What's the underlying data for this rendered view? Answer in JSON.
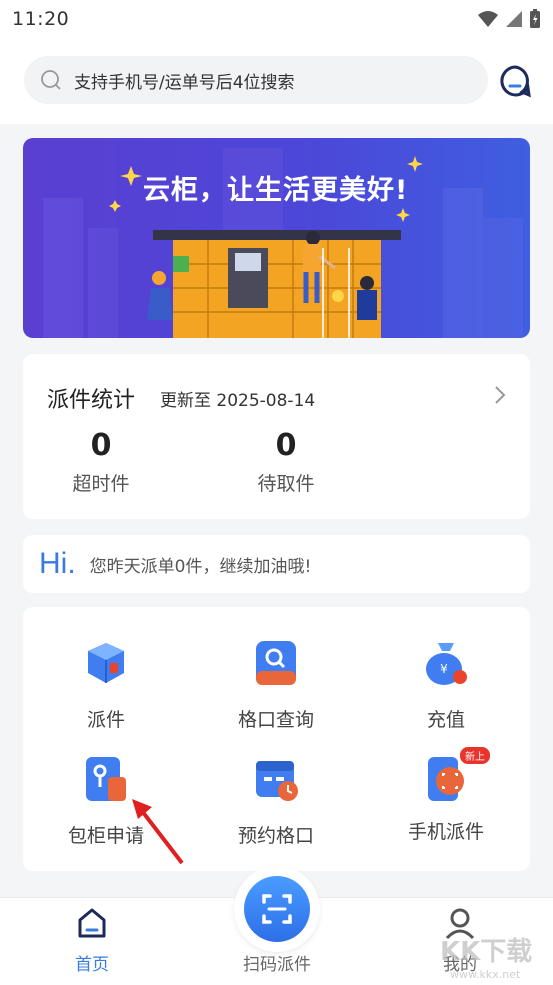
{
  "status_bar": {
    "time": "11:20"
  },
  "search": {
    "placeholder": "支持手机号/运单号后4位搜索"
  },
  "banner": {
    "title": "云柜，让生活更美好!"
  },
  "stats": {
    "title": "派件统计",
    "updated": "更新至 2025-08-14",
    "items": [
      {
        "value": "0",
        "label": "超时件"
      },
      {
        "value": "0",
        "label": "待取件"
      }
    ]
  },
  "greeting": {
    "hi": "Hi.",
    "message": "您昨天派单0件，继续加油哦!"
  },
  "grid": {
    "items": [
      {
        "label": "派件",
        "icon": "package-icon"
      },
      {
        "label": "格口查询",
        "icon": "search-locker-icon"
      },
      {
        "label": "充值",
        "icon": "money-bag-icon"
      },
      {
        "label": "包柜申请",
        "icon": "key-locker-icon"
      },
      {
        "label": "预约格口",
        "icon": "calendar-clock-icon"
      },
      {
        "label": "手机派件",
        "icon": "phone-scan-icon",
        "badge": "新上"
      }
    ]
  },
  "tabbar": {
    "tabs": [
      {
        "label": "首页",
        "active": true
      },
      {
        "label": "扫码派件"
      },
      {
        "label": "我的"
      }
    ]
  },
  "colors": {
    "accent": "#3a7be0",
    "banner": "#4c47d8",
    "badge": "#e8342c"
  }
}
